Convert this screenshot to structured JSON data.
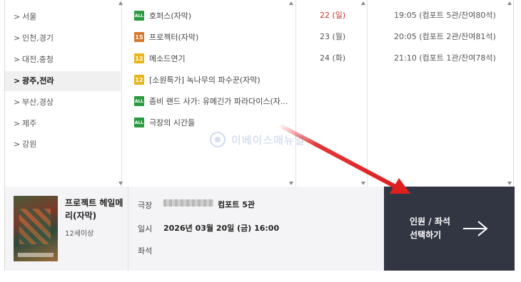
{
  "regions": [
    {
      "label": "서울",
      "selected": false
    },
    {
      "label": "인천,경기",
      "selected": false
    },
    {
      "label": "대전,충청",
      "selected": false
    },
    {
      "label": "광주,전라",
      "selected": true
    },
    {
      "label": "부산,경상",
      "selected": false
    },
    {
      "label": "제주",
      "selected": false
    },
    {
      "label": "강원",
      "selected": false
    }
  ],
  "region_arrow": ">",
  "movies": [
    {
      "rating": "ALL",
      "title": "호퍼스(자막)"
    },
    {
      "rating": "15",
      "title": "프로젝터(자막)"
    },
    {
      "rating": "12",
      "title": "메소드연기"
    },
    {
      "rating": "12",
      "title": "[소원특가] 녹나무의 파수꾼(자막)"
    },
    {
      "rating": "ALL",
      "title": "좀비 랜드 사가: 유메긴가 파라다이스(자..."
    },
    {
      "rating": "ALL",
      "title": "극장의 시간들"
    }
  ],
  "dates": [
    {
      "label": "22 (일)",
      "sunday": true
    },
    {
      "label": "23 (월)",
      "sunday": false
    },
    {
      "label": "24 (화)",
      "sunday": false
    }
  ],
  "times": [
    "19:05 (컴포트 5관/잔여80석)",
    "20:05 (컴포트 2관/잔여81석)",
    "21:10 (컴포트 1관/잔여78석)"
  ],
  "watermark": "이베이스매뉴얼",
  "selection": {
    "movie_title": "프로젝트 헤일메리(자막)",
    "age": "12세이상",
    "theater_label": "극장",
    "theater_value": "컴포트 5관",
    "datetime_label": "일시",
    "datetime_value": "2026년 03월 20일 (금) 16:00",
    "seat_label": "좌석"
  },
  "next_button": {
    "line1": "인원 / 좌석",
    "line2": "선택하기",
    "icon": "arrow-right-icon"
  },
  "colors": {
    "sunday": "#c8322a",
    "panel": "#323643",
    "rating_all": "#2a9b3f",
    "rating_15": "#d4782e",
    "rating_12": "#e8b51c",
    "annotation_arrow": "#e02020"
  }
}
